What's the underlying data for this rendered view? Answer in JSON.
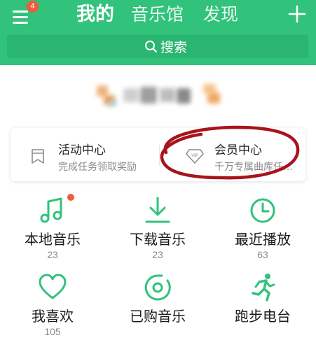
{
  "header": {
    "badge_count": "4",
    "tabs": [
      {
        "label": "我的",
        "active": true
      },
      {
        "label": "音乐馆",
        "active": false
      },
      {
        "label": "发现",
        "active": false
      }
    ],
    "plus_icon": "plus-icon",
    "menu_icon": "hamburger-menu-icon"
  },
  "search": {
    "label": "搜索",
    "icon": "search-icon"
  },
  "profile": {
    "avatar": "blurred-avatar"
  },
  "cards": [
    {
      "title": "活动中心",
      "subtitle": "完成任务领取奖励",
      "icon": "bookmark-icon"
    },
    {
      "title": "会员中心",
      "subtitle": "千万专属曲库任…",
      "icon": "vip-diamond-icon"
    }
  ],
  "grid": [
    {
      "label": "本地音乐",
      "count": "23",
      "icon": "music-note-icon"
    },
    {
      "label": "下载音乐",
      "count": "23",
      "icon": "download-icon"
    },
    {
      "label": "最近播放",
      "count": "63",
      "icon": "clock-icon"
    },
    {
      "label": "我喜欢",
      "count": "105",
      "icon": "heart-icon"
    },
    {
      "label": "已购音乐",
      "count": "",
      "icon": "purchased-disc-icon"
    },
    {
      "label": "跑步电台",
      "count": "",
      "icon": "running-icon"
    }
  ],
  "colors": {
    "brand_green": "#31c27c",
    "search_bg": "#2ab570",
    "badge_red": "#f15a3a",
    "annotation_red": "#a8141c"
  }
}
